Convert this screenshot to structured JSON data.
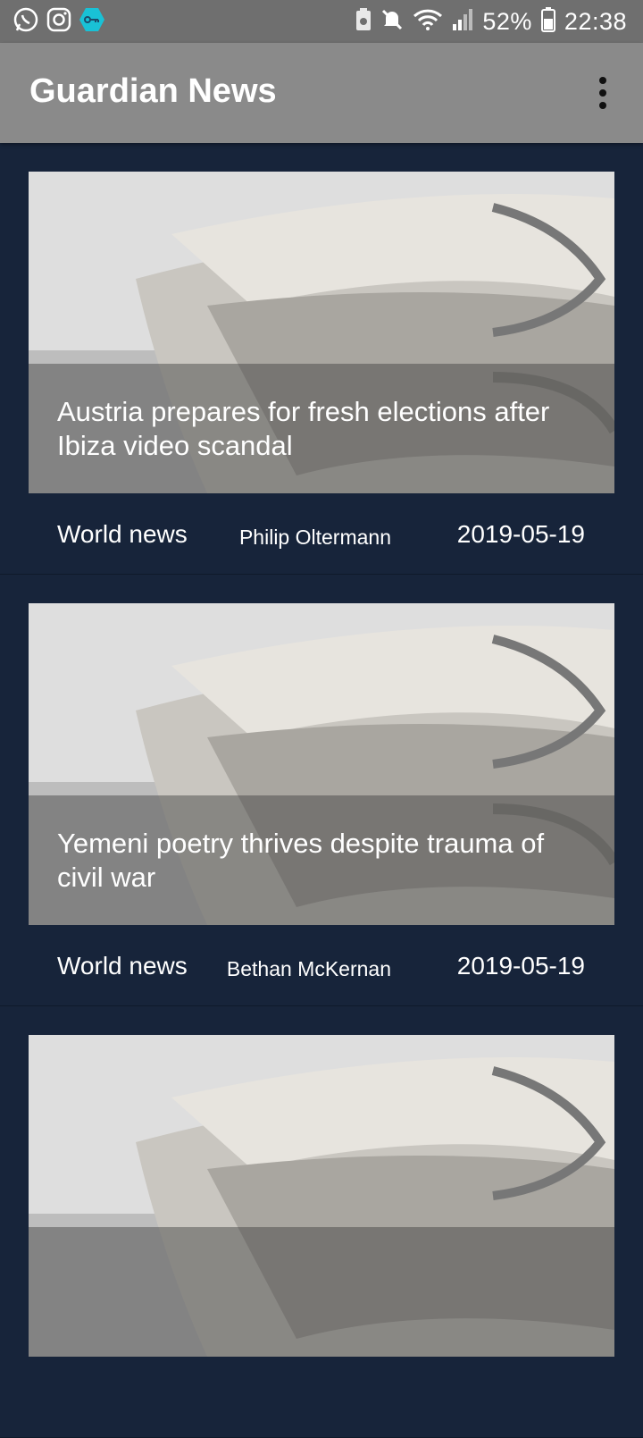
{
  "status_bar": {
    "left_icons": [
      "whatsapp-icon",
      "instagram-icon",
      "vpn-key-icon"
    ],
    "right_icons": [
      "battery-saver-icon",
      "mute-icon",
      "wifi-icon",
      "signal-icon"
    ],
    "battery_percent": "52%",
    "time": "22:38"
  },
  "app_bar": {
    "title": "Guardian News",
    "menu_icon": "overflow-menu-icon"
  },
  "articles": [
    {
      "headline": "Austria prepares for fresh elections after Ibiza video scandal",
      "section": "World news",
      "author": "Philip Oltermann",
      "date": "2019-05-19"
    },
    {
      "headline": "Yemeni poetry thrives despite trauma of civil war",
      "section": "World news",
      "author": "Bethan McKernan",
      "date": "2019-05-19"
    },
    {
      "headline": "",
      "section": "",
      "author": "",
      "date": ""
    }
  ],
  "colors": {
    "list_background": "#17243a",
    "app_bar": "#8a8a8a",
    "status_bar": "#6f6f6f",
    "vpn_icon_accent": "#19c1d6"
  }
}
